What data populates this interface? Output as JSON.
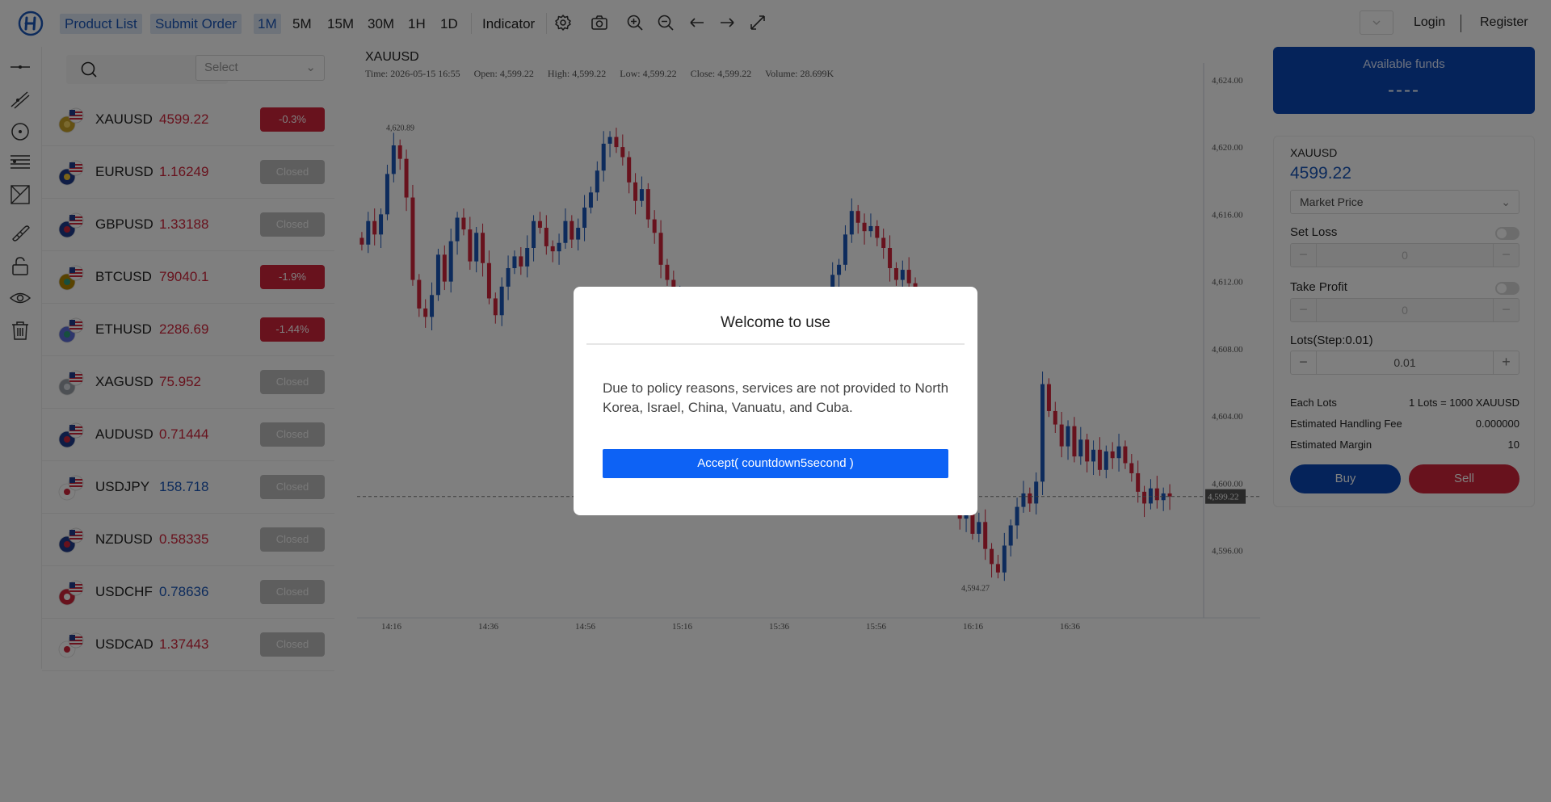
{
  "header": {
    "logo_icon": "app-logo-icon",
    "nav": {
      "product_list": "Product List",
      "submit_order": "Submit Order"
    },
    "timeframes": [
      "1M",
      "5M",
      "15M",
      "30M",
      "1H",
      "1D"
    ],
    "active_timeframe": "1M",
    "indicator": "Indicator",
    "icons": [
      "gear-icon",
      "camera-icon",
      "zoom-in-icon",
      "zoom-out-icon",
      "arrow-left-icon",
      "arrow-right-icon",
      "fullscreen-icon"
    ],
    "login": "Login",
    "register": "Register"
  },
  "tools": [
    "horizontal-line-icon",
    "trend-line-icon",
    "circle-icon",
    "fibonacci-icon",
    "shape-icon",
    "ruler-icon",
    "lock-icon",
    "eye-icon",
    "trash-icon"
  ],
  "products": {
    "select_placeholder": "Select",
    "items": [
      {
        "symbol": "XAUUSD",
        "price": "4599.22",
        "price_color": "red",
        "change": "-0.3%",
        "status": "down",
        "flag": "gold-flag"
      },
      {
        "symbol": "EURUSD",
        "price": "1.16249",
        "price_color": "red",
        "change": "Closed",
        "status": "closed",
        "flag": "eu-flag"
      },
      {
        "symbol": "GBPUSD",
        "price": "1.33188",
        "price_color": "red",
        "change": "Closed",
        "status": "closed",
        "flag": "uk-flag"
      },
      {
        "symbol": "BTCUSD",
        "price": "79040.1",
        "price_color": "red",
        "change": "-1.9%",
        "status": "down",
        "flag": "btc-flag"
      },
      {
        "symbol": "ETHUSD",
        "price": "2286.69",
        "price_color": "red",
        "change": "-1.44%",
        "status": "down",
        "flag": "eth-flag"
      },
      {
        "symbol": "XAGUSD",
        "price": "75.952",
        "price_color": "red",
        "change": "Closed",
        "status": "closed",
        "flag": "silver-flag"
      },
      {
        "symbol": "AUDUSD",
        "price": "0.71444",
        "price_color": "red",
        "change": "Closed",
        "status": "closed",
        "flag": "au-flag"
      },
      {
        "symbol": "USDJPY",
        "price": "158.718",
        "price_color": "blue",
        "change": "Closed",
        "status": "closed",
        "flag": "jp-flag"
      },
      {
        "symbol": "NZDUSD",
        "price": "0.58335",
        "price_color": "red",
        "change": "Closed",
        "status": "closed",
        "flag": "nz-flag"
      },
      {
        "symbol": "USDCHF",
        "price": "0.78636",
        "price_color": "blue",
        "change": "Closed",
        "status": "closed",
        "flag": "ch-flag"
      },
      {
        "symbol": "USDCAD",
        "price": "1.37443",
        "price_color": "red",
        "change": "Closed",
        "status": "closed",
        "flag": "ca-flag"
      }
    ]
  },
  "chart_header": {
    "symbol": "XAUUSD",
    "time": "Time: 2026-05-15 16:55",
    "open": "Open: 4,599.22",
    "high": "High: 4,599.22",
    "low": "Low: 4,599.22",
    "close": "Close: 4,599.22",
    "volume": "Volume: 28.699K"
  },
  "chart_data": {
    "type": "candlestick",
    "symbol": "XAUUSD",
    "y_ticks": [
      "4,624.00",
      "4,620.00",
      "4,616.00",
      "4,612.00",
      "4,608.00",
      "4,604.00",
      "4,600.00",
      "4,596.00"
    ],
    "ylim": [
      4592,
      4625
    ],
    "x_ticks": [
      "14:16",
      "14:36",
      "14:56",
      "15:16",
      "15:36",
      "15:56",
      "16:16",
      "16:36"
    ],
    "last_price": 4599.22,
    "last_price_label": "4,599.22",
    "high_label": "4,620.89",
    "low_label": "4,594.27",
    "up_color": "#1a56b8",
    "down_color": "#d1243a",
    "closes": [
      4614.2,
      4615.6,
      4614.8,
      4616.0,
      4618.4,
      4620.1,
      4619.3,
      4617.0,
      4612.1,
      4610.4,
      4609.9,
      4611.2,
      4613.6,
      4612.0,
      4614.4,
      4615.8,
      4615.1,
      4613.2,
      4614.9,
      4613.1,
      4611.0,
      4610.0,
      4611.7,
      4612.8,
      4613.5,
      4612.9,
      4614.0,
      4615.6,
      4615.2,
      4614.1,
      4613.8,
      4614.3,
      4615.6,
      4614.5,
      4615.2,
      4616.4,
      4617.3,
      4618.6,
      4620.2,
      4620.6,
      4620.0,
      4619.4,
      4617.9,
      4616.8,
      4617.5,
      4615.7,
      4614.9,
      4613.0,
      4612.1,
      4610.2,
      4611.0,
      4609.0,
      4610.6,
      4608.0,
      4606.4,
      4607.7,
      4605.2,
      4604.0,
      4605.5,
      4603.8,
      4602.9,
      4601.4,
      4603.0,
      4604.5,
      4605.0,
      4603.6,
      4602.4,
      4603.7,
      4605.1,
      4606.0,
      4607.3,
      4608.6,
      4609.9,
      4611.0,
      4612.4,
      4613.0,
      4614.8,
      4616.2,
      4615.5,
      4615.0,
      4615.3,
      4614.6,
      4614.0,
      4612.8,
      4612.1,
      4612.7,
      4611.9,
      4610.0,
      4608.2,
      4606.0,
      4604.3,
      4602.4,
      4600.3,
      4598.6,
      4597.9,
      4598.3,
      4597.0,
      4597.7,
      4596.1,
      4595.2,
      4594.7,
      4596.3,
      4597.5,
      4598.6,
      4599.4,
      4598.8,
      4600.1,
      4605.9,
      4604.3,
      4603.5,
      4602.2,
      4603.4,
      4601.6,
      4602.6,
      4601.3,
      4602.0,
      4600.8,
      4601.9,
      4601.5,
      4602.2,
      4601.2,
      4600.6,
      4599.5,
      4598.8,
      4599.7,
      4599.0,
      4599.4,
      4599.22
    ],
    "series_note": ""
  },
  "right_panel": {
    "funds_label": "Available funds",
    "funds_value": "----",
    "symbol": "XAUUSD",
    "price": "4599.22",
    "order_type": "Market Price",
    "set_loss": "Set Loss",
    "set_loss_value": "0",
    "take_profit": "Take Profit",
    "take_profit_value": "0",
    "lots_label": "Lots(Step:0.01)",
    "lots_value": "0.01",
    "each_lots_label": "Each Lots",
    "each_lots_value": "1 Lots = 1000 XAUUSD",
    "fee_label": "Estimated Handling Fee",
    "fee_value": "0.000000",
    "margin_label": "Estimated Margin",
    "margin_value": "10",
    "buy": "Buy",
    "sell": "Sell",
    "minus": "−",
    "plus": "+"
  },
  "modal": {
    "title": "Welcome to use",
    "message": "Due to policy reasons, services are not provided to North Korea, Israel, China, Vanuatu, and Cuba.",
    "accept": "Accept( countdown5second )"
  }
}
